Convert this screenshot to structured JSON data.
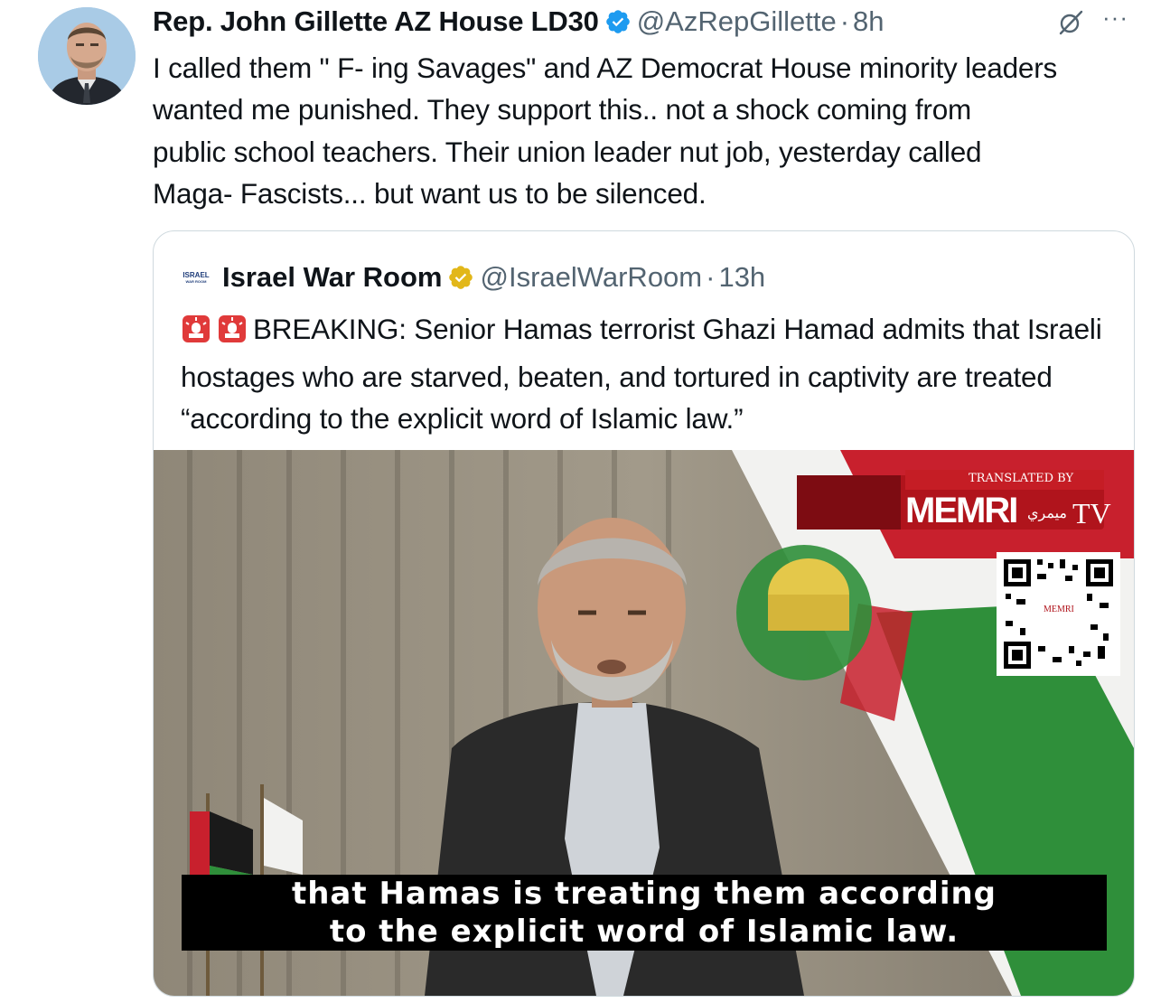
{
  "tweet": {
    "author_name": "Rep. John Gillette AZ House LD30",
    "handle": "@AzRepGillette",
    "separator": "·",
    "time": "8h",
    "more_label": "···",
    "text": "I called them \" F- ing Savages\" and AZ Democrat House minority leaders\nwanted me punished. They support this.. not a shock coming from\npublic school teachers. Their union leader nut job, yesterday called\nMaga- Fascists... but want us to be silenced."
  },
  "quoted": {
    "author_name": "Israel War Room",
    "handle": "@IsraelWarRoom",
    "separator": "·",
    "time": "13h",
    "logo_text_top": "ISRAEL",
    "logo_text_bottom": "WAR ROOM",
    "text": "BREAKING: Senior Hamas terrorist Ghazi Hamad admits that Israeli hostages who are starved, beaten, and tortured in captivity are treated “according to the explicit word of Islamic law.”",
    "video": {
      "caption_line1": "that Hamas is treating them according",
      "caption_line2": "to the explicit word of Islamic law.",
      "watermark_translated": "TRANSLATED BY",
      "watermark_brand": "MEMRI",
      "watermark_tv": "TV",
      "watermark_arabic": "ميمري",
      "qr_label": "MEMRI"
    }
  },
  "colors": {
    "verified_blue": "#1d9bf0",
    "verified_gold": "#e2b719",
    "secondary_text": "#536471",
    "border": "#cfd9de"
  },
  "icons": [
    "verified-badge-icon",
    "grok-icon",
    "more-icon",
    "siren-icon"
  ]
}
